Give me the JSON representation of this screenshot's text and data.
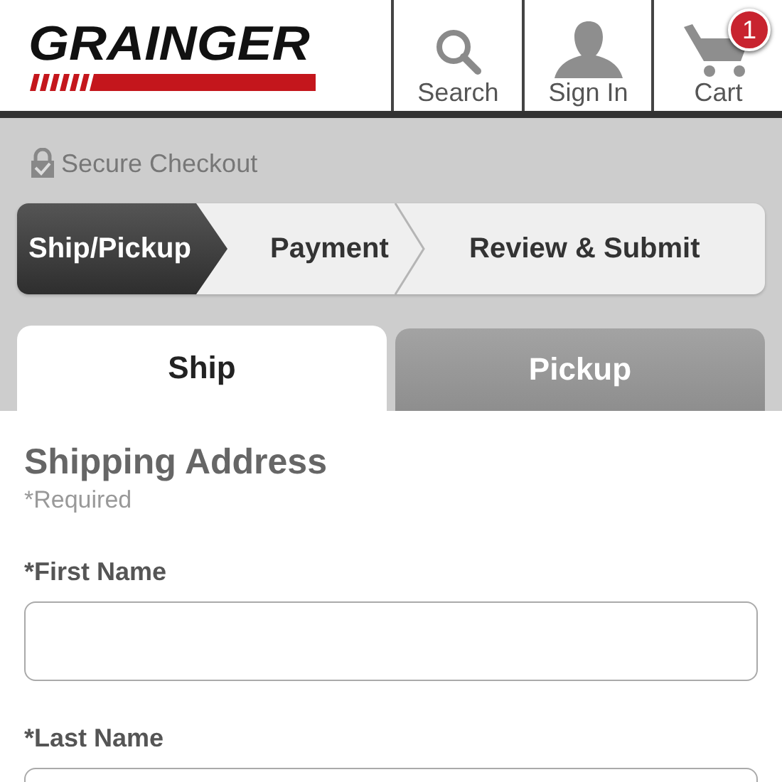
{
  "header": {
    "logo": "GRAINGER",
    "nav": [
      {
        "kind": "search",
        "label": "Search"
      },
      {
        "kind": "account",
        "label": "Sign In"
      },
      {
        "kind": "cart",
        "label": "Cart",
        "badge": "1"
      }
    ]
  },
  "secure_label": "Secure Checkout",
  "steps": [
    {
      "label": "Ship/Pickup",
      "selected": true
    },
    {
      "label": "Payment",
      "selected": false
    },
    {
      "label": "Review & Submit",
      "selected": false
    }
  ],
  "tabs": [
    {
      "label": "Ship",
      "selected": true
    },
    {
      "label": "Pickup",
      "selected": false
    }
  ],
  "form": {
    "title": "Shipping Address",
    "note": "*Required",
    "fields": [
      {
        "label": "*First Name"
      },
      {
        "label": "*Last Name"
      }
    ]
  }
}
